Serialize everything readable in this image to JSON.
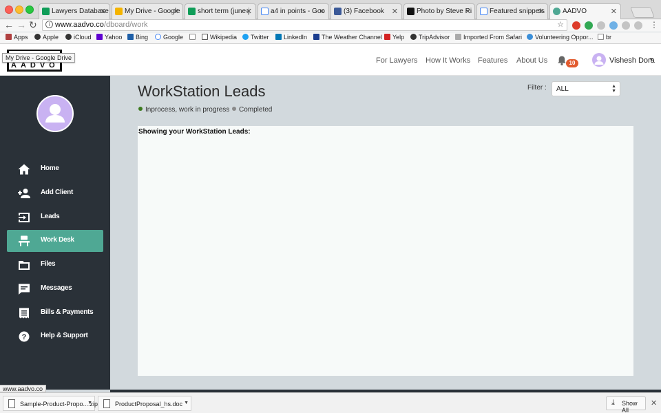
{
  "browser": {
    "tabs": [
      {
        "title": "Lawyers Database",
        "icon": "sheets-icon",
        "color": "#0f9d58",
        "active": false
      },
      {
        "title": "My Drive - Google",
        "icon": "drive-icon",
        "color": "#f4b400",
        "active": false
      },
      {
        "title": "short term (june-j",
        "icon": "sheets-icon",
        "color": "#0f9d58",
        "active": false
      },
      {
        "title": "a4 in points - Goo",
        "icon": "google-icon",
        "color": "#4285f4",
        "active": false
      },
      {
        "title": "(3) Facebook",
        "icon": "facebook-icon",
        "color": "#3b5998",
        "active": false
      },
      {
        "title": "Photo by Steve Ri",
        "icon": "camera-icon",
        "color": "#111111",
        "active": false
      },
      {
        "title": "Featured snippets",
        "icon": "google-icon",
        "color": "#4285f4",
        "active": false
      },
      {
        "title": "AADVO",
        "icon": "chat-icon",
        "color": "#4fa894",
        "active": true
      }
    ],
    "url_host": "www.aadvo.co",
    "url_path": "/dboard/work",
    "bookmarks": [
      "Apps",
      "Apple",
      "iCloud",
      "Yahoo",
      "Bing",
      "Google",
      "",
      "Wikipedia",
      "Twitter",
      "LinkedIn",
      "The Weather Channel",
      "Yelp",
      "TripAdvisor",
      "Imported From Safari",
      "Volunteering Oppor...",
      "br"
    ],
    "tooltip": "My Drive - Google Drive",
    "status_url": "www.aadvo.co"
  },
  "header": {
    "logo_text": "AADVO",
    "nav": [
      "For Lawyers",
      "How It Works",
      "Features",
      "About Us"
    ],
    "notification_count": "10",
    "user_name": "Vishesh Dora",
    "colors": {
      "badge": "#e25b2f",
      "avatar": "#c9b2f2"
    }
  },
  "sidebar": {
    "items": [
      {
        "label": "Home",
        "icon": "home-icon",
        "active": false
      },
      {
        "label": "Add Client",
        "icon": "add-person-icon",
        "active": false
      },
      {
        "label": "Leads",
        "icon": "leads-icon",
        "active": false
      },
      {
        "label": "Work Desk",
        "icon": "desk-icon",
        "active": true
      },
      {
        "label": "Files",
        "icon": "folder-icon",
        "active": false
      },
      {
        "label": "Messages",
        "icon": "message-icon",
        "active": false
      },
      {
        "label": "Bills & Payments",
        "icon": "receipt-icon",
        "active": false
      },
      {
        "label": "Help & Support",
        "icon": "help-icon",
        "active": false
      }
    ],
    "colors": {
      "background": "#2a3138",
      "active": "#4fa894"
    }
  },
  "main": {
    "title": "WorkStation Leads",
    "legend": [
      {
        "label": "Inprocess, work in progress",
        "color": "#3c7a1e"
      },
      {
        "label": "Completed",
        "color": "#8a8a8a"
      }
    ],
    "filter_label": "Filter :",
    "filter_value": "ALL",
    "panel_heading": "Showing your WorkStation Leads:"
  },
  "downloads": {
    "items": [
      "Sample-Product-Propo....zip",
      "ProductProposal_hs.doc"
    ],
    "show_all": "Show All"
  }
}
